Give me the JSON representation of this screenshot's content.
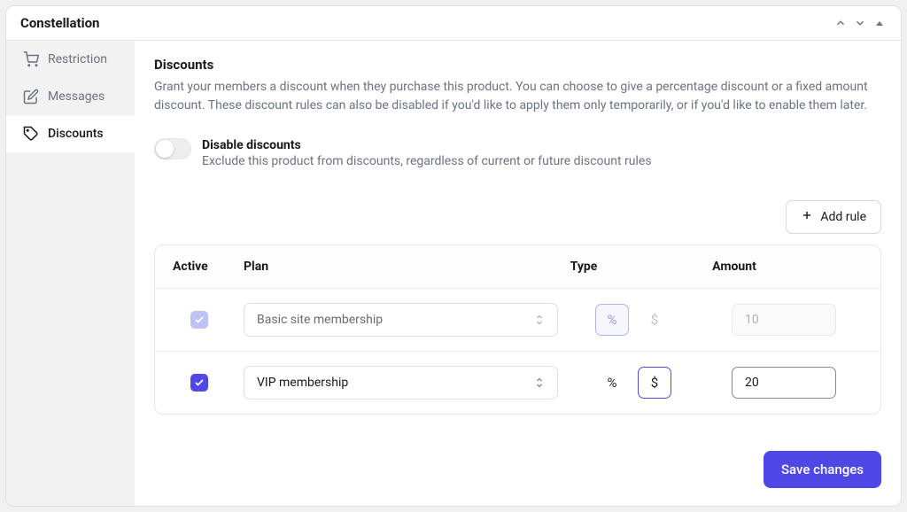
{
  "window": {
    "title": "Constellation"
  },
  "sidebar": {
    "items": [
      {
        "label": "Restriction"
      },
      {
        "label": "Messages"
      },
      {
        "label": "Discounts"
      }
    ]
  },
  "section": {
    "title": "Discounts",
    "description": "Grant your members a discount when they purchase this product. You can choose to give a percentage discount or a fixed amount discount. These discount rules can also be disabled if you'd like to apply them only temporarily, or if you'd like to enable them later."
  },
  "disable_toggle": {
    "title": "Disable discounts",
    "desc": "Exclude this product from discounts, regardless of current or future discount rules"
  },
  "add_rule_label": "Add rule",
  "table": {
    "headers": {
      "active": "Active",
      "plan": "Plan",
      "type": "Type",
      "amount": "Amount"
    },
    "rows": [
      {
        "plan": "Basic site membership",
        "amount": "10"
      },
      {
        "plan": "VIP membership",
        "amount": "20"
      }
    ]
  },
  "symbols": {
    "percent": "%",
    "dollar": "$"
  },
  "save_label": "Save changes"
}
